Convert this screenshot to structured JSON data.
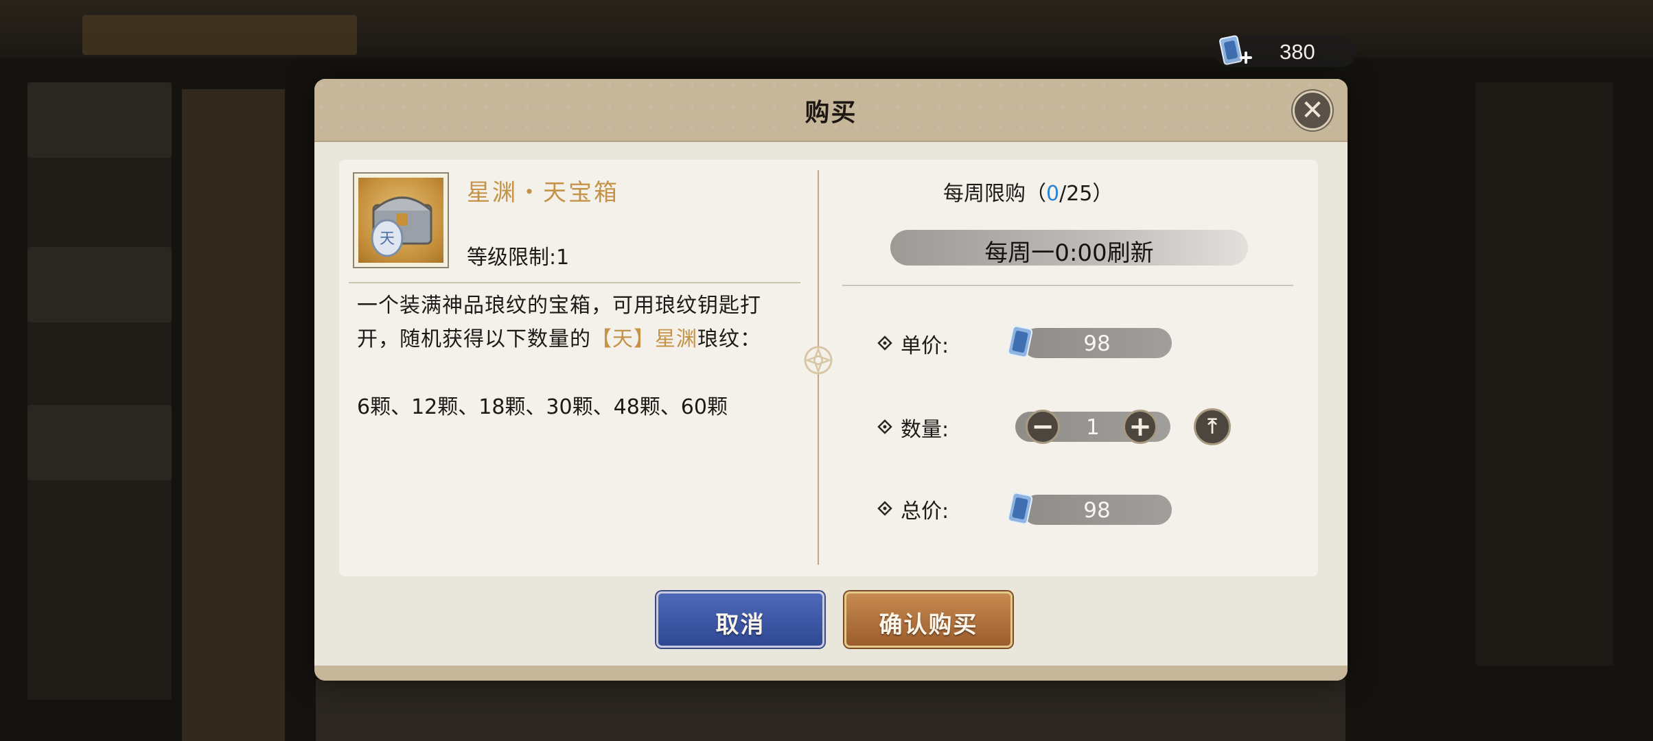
{
  "currency": {
    "icon": "scroll-ticket-plus-icon",
    "amount": "380"
  },
  "modal": {
    "title": "购买",
    "close_icon": "close-x-icon"
  },
  "item": {
    "name": "星渊・天宝箱",
    "icon": "treasure-chest-icon",
    "level_limit": "等级限制:1",
    "description_part1": "一个装满神品琅纹的宝箱，可用琅纹钥匙打开，随机获得以下数量的",
    "description_highlight": "【天】星渊",
    "description_part2": "琅纹：",
    "quantities": "6颗、12颗、18颗、30颗、48颗、60颗"
  },
  "purchase": {
    "weekly_limit_prefix": "每周限购（",
    "weekly_limit_current": "0",
    "weekly_limit_suffix": "/25）",
    "refresh_text": "每周一0:00刷新",
    "unit_price_label": "单价:",
    "unit_price": "98",
    "quantity_label": "数量:",
    "quantity": "1",
    "total_price_label": "总价:",
    "total_price": "98",
    "currency_icon": "scroll-ticket-icon",
    "minus_icon": "minus-icon",
    "plus_icon": "plus-icon",
    "max_icon": "max-arrow-up-icon"
  },
  "actions": {
    "cancel_label": "取消",
    "confirm_label": "确认购买"
  },
  "colors": {
    "gold_text": "#c49349",
    "highlight_blue": "#2b83d8",
    "cancel_button": "#3b55a6",
    "confirm_button": "#b06f3a",
    "header_bg": "#c6b69a"
  }
}
